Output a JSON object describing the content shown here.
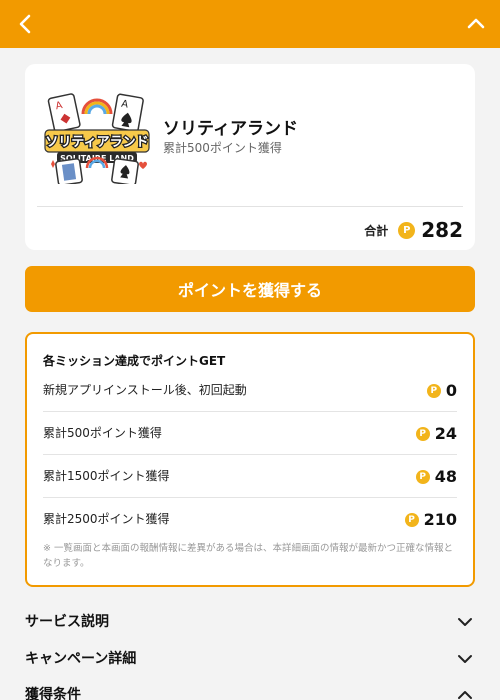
{
  "header": {
    "back_icon": "chevron-left-icon",
    "collapse_icon": "chevron-up-icon",
    "color": "#f29a00"
  },
  "app": {
    "name": "ソリティアランド",
    "subtitle": "累計500ポイント獲得",
    "total_label": "合計",
    "total_value": "282",
    "coin_glyph": "P",
    "logo": {
      "title_jp": "ソリティアランド",
      "title_en": "SOLITAIRE LAND"
    }
  },
  "cta": {
    "label": "ポイントを獲得する"
  },
  "missions": {
    "title": "各ミッション達成でポイントGET",
    "items": [
      {
        "label": "新規アプリインストール後、初回起動",
        "points": "0"
      },
      {
        "label": "累計500ポイント獲得",
        "points": "24"
      },
      {
        "label": "累計1500ポイント獲得",
        "points": "48"
      },
      {
        "label": "累計2500ポイント獲得",
        "points": "210"
      }
    ],
    "note": "※ 一覧画面と本画面の報酬情報に差異がある場合は、本詳細画面の情報が最新かつ正確な情報となります。"
  },
  "sections": [
    {
      "label": "サービス説明",
      "icon": "chevron-down-icon"
    },
    {
      "label": "キャンペーン詳細",
      "icon": "chevron-down-icon"
    },
    {
      "label": "獲得条件",
      "icon": "chevron-up-icon"
    }
  ],
  "colors": {
    "accent": "#f29a00",
    "coin": "#f2b41b",
    "background": "#f3f3f3"
  }
}
